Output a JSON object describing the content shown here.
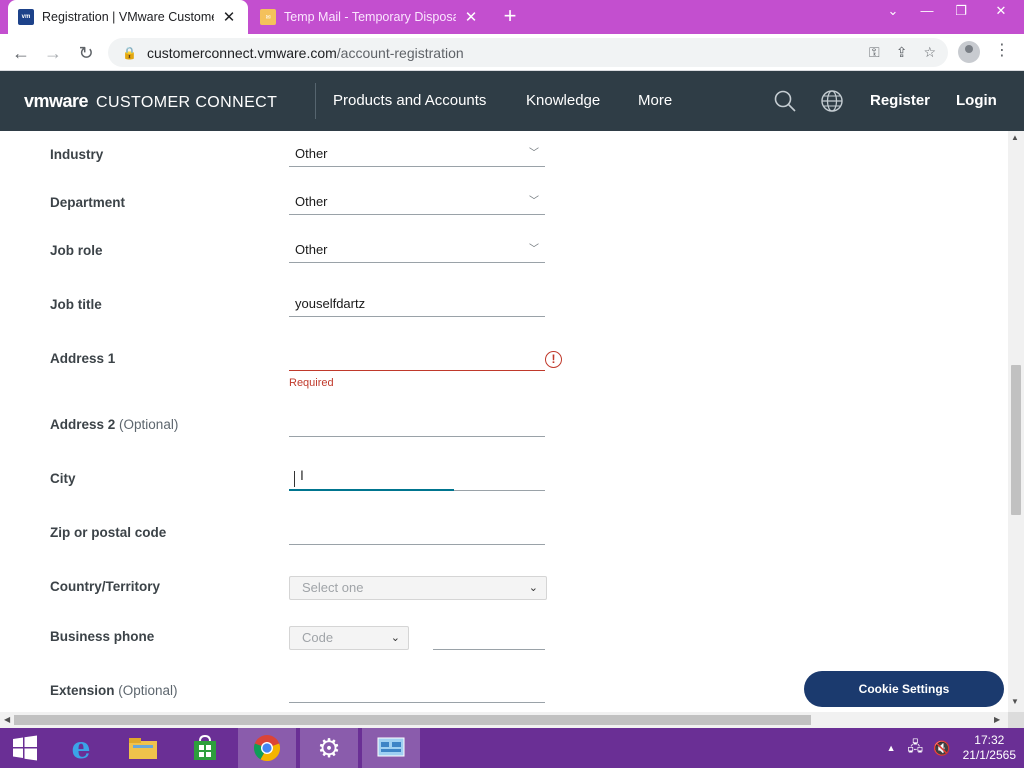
{
  "browser": {
    "tabs": [
      {
        "title": "Registration | VMware Customer",
        "favicon": "vmware-favicon",
        "active": true
      },
      {
        "title": "Temp Mail - Temporary Disposab",
        "favicon": "temp-mail-favicon",
        "active": false
      }
    ],
    "url_host": "customerconnect.vmware.com",
    "url_path": "/account-registration",
    "tab_close_glyph": "✕",
    "new_tab_glyph": "+",
    "accent_color": "#c34fcf"
  },
  "header": {
    "logo_vm": "vmware",
    "logo_product": "CUSTOMER CONNECT",
    "nav": [
      "Products and Accounts",
      "Knowledge",
      "More"
    ],
    "register": "Register",
    "login": "Login",
    "background": "#2f3d46"
  },
  "form": {
    "industry": {
      "label": "Industry",
      "value": "Other"
    },
    "department": {
      "label": "Department",
      "value": "Other"
    },
    "job_role": {
      "label": "Job role",
      "value": "Other"
    },
    "job_title": {
      "label": "Job title",
      "value": "youselfdartz"
    },
    "address1": {
      "label": "Address 1",
      "value": "",
      "error": "Required",
      "error_glyph": "!"
    },
    "address2": {
      "label": "Address 2",
      "optional": "(Optional)",
      "value": ""
    },
    "city": {
      "label": "City",
      "value": ""
    },
    "zip": {
      "label": "Zip or postal code",
      "value": ""
    },
    "country": {
      "label": "Country/Territory",
      "placeholder": "Select one"
    },
    "business_phone": {
      "label": "Business phone",
      "code_placeholder": "Code",
      "number": ""
    },
    "extension": {
      "label": "Extension",
      "optional": "(Optional)",
      "value": ""
    }
  },
  "cookie_button": "Cookie Settings",
  "taskbar": {
    "time": "17:32",
    "date": "21/1/2565",
    "apps": [
      "internet-explorer",
      "file-explorer",
      "store",
      "chrome",
      "settings",
      "control-panel"
    ]
  }
}
